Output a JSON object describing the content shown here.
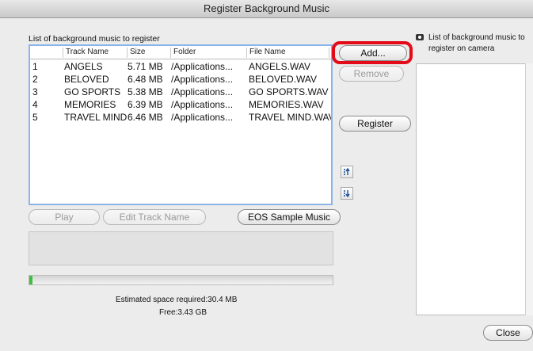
{
  "window": {
    "title": "Register Background Music"
  },
  "left": {
    "list_title": "List of background music to register",
    "columns": [
      "",
      "Track Name",
      "Size",
      "Folder",
      "File Name"
    ],
    "rows": [
      [
        "1",
        "ANGELS",
        "5.71 MB",
        "/Applications...",
        "ANGELS.WAV"
      ],
      [
        "2",
        "BELOVED",
        "6.48 MB",
        "/Applications...",
        "BELOVED.WAV"
      ],
      [
        "3",
        "GO SPORTS",
        "5.38 MB",
        "/Applications...",
        "GO SPORTS.WAV"
      ],
      [
        "4",
        "MEMORIES",
        "6.39 MB",
        "/Applications...",
        "MEMORIES.WAV"
      ],
      [
        "5",
        "TRAVEL MIND",
        "6.46 MB",
        "/Applications...",
        "TRAVEL MIND.WAV"
      ]
    ]
  },
  "buttons": {
    "add": "Add...",
    "remove": "Remove",
    "register": "Register",
    "play": "Play",
    "edit_track_name": "Edit Track Name",
    "eos_sample_music": "EOS Sample Music",
    "close": "Close"
  },
  "icons": {
    "move_up": "move-up-icon",
    "move_down": "move-down-icon",
    "camera": "camera-icon"
  },
  "info": {
    "estimated_space": "Estimated space required:30.4 MB",
    "free": "Free:3.43 GB",
    "progress_fraction": 0.01
  },
  "right": {
    "title_line1": "List of background music to",
    "title_line2": "register on camera"
  },
  "colors": {
    "highlight": "#e30b17",
    "progress": "#3fbf3f",
    "list_border": "#8bb4e8"
  }
}
